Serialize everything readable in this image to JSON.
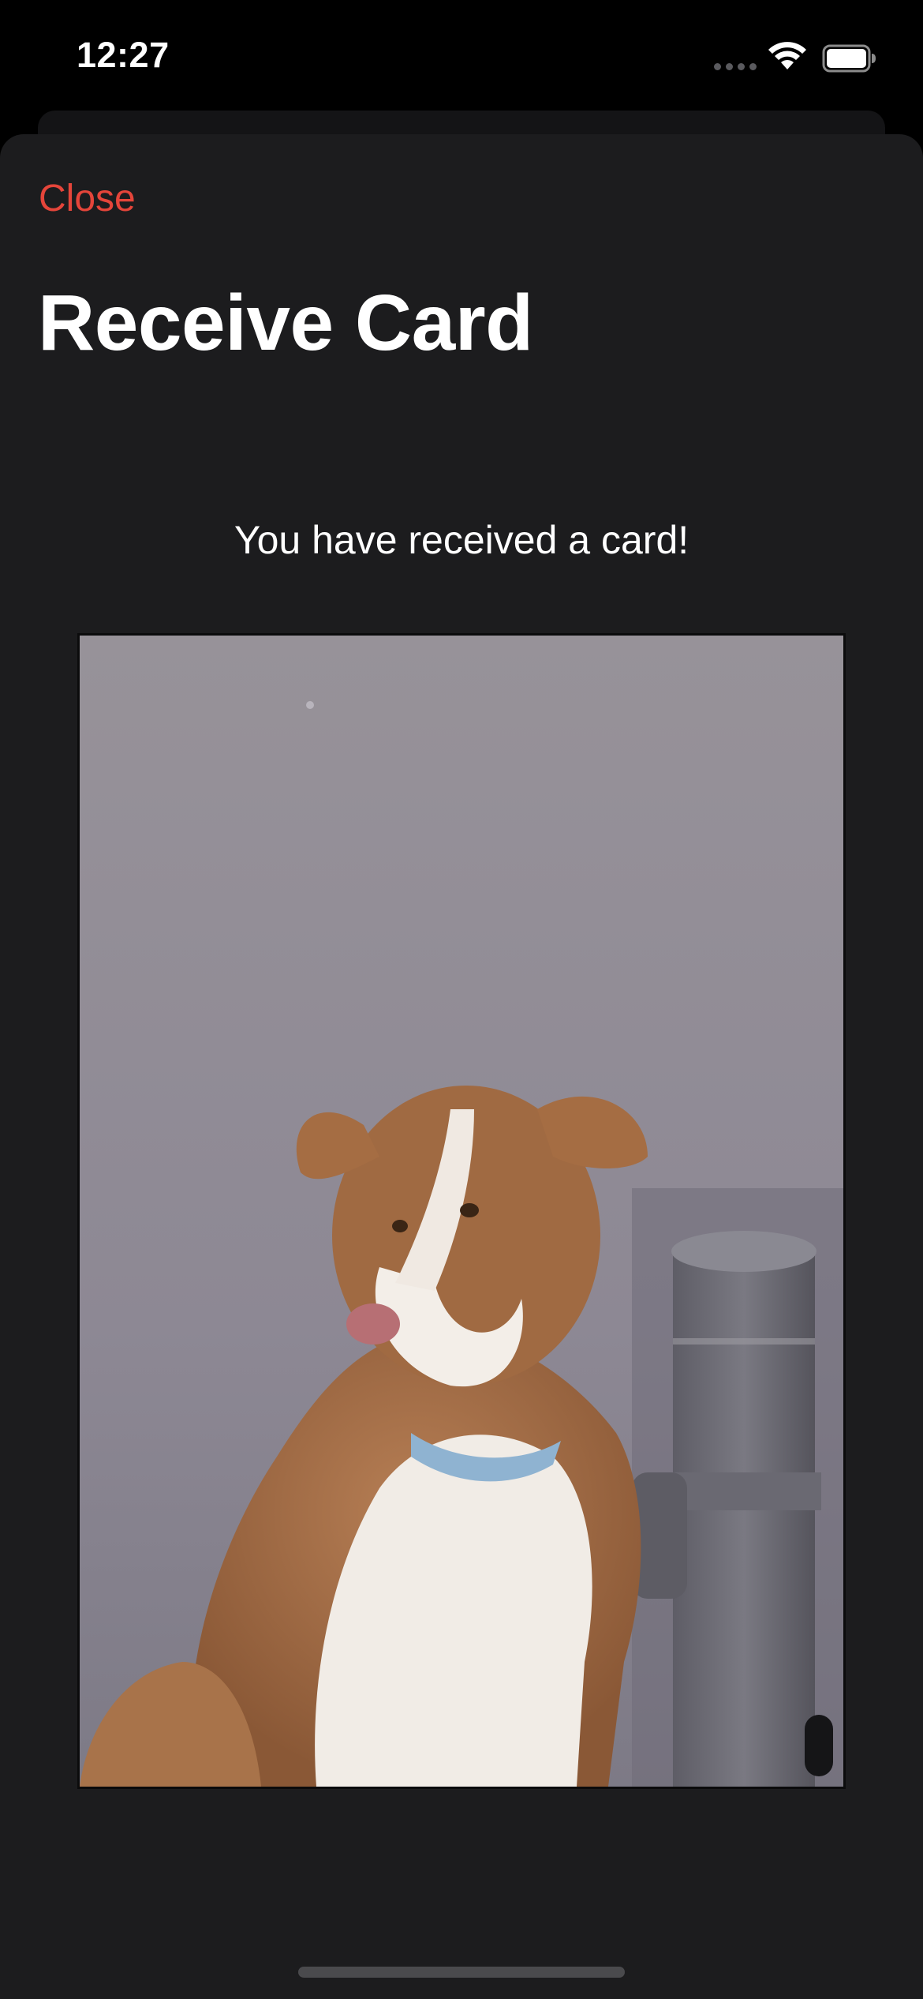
{
  "status_bar": {
    "time": "12:27",
    "signal_icon": "cellular-signal-icon",
    "wifi_icon": "wifi-icon",
    "battery_icon": "battery-full-icon"
  },
  "nav": {
    "close_label": "Close",
    "title": "Receive Card"
  },
  "content": {
    "message": "You have received a card!",
    "card_image": {
      "subject": "photo of brown and white dog sitting beside a grey pipe against a grey wall"
    }
  },
  "colors": {
    "accent": "#e5453a",
    "background": "#1c1c1e",
    "text": "#ffffff"
  }
}
